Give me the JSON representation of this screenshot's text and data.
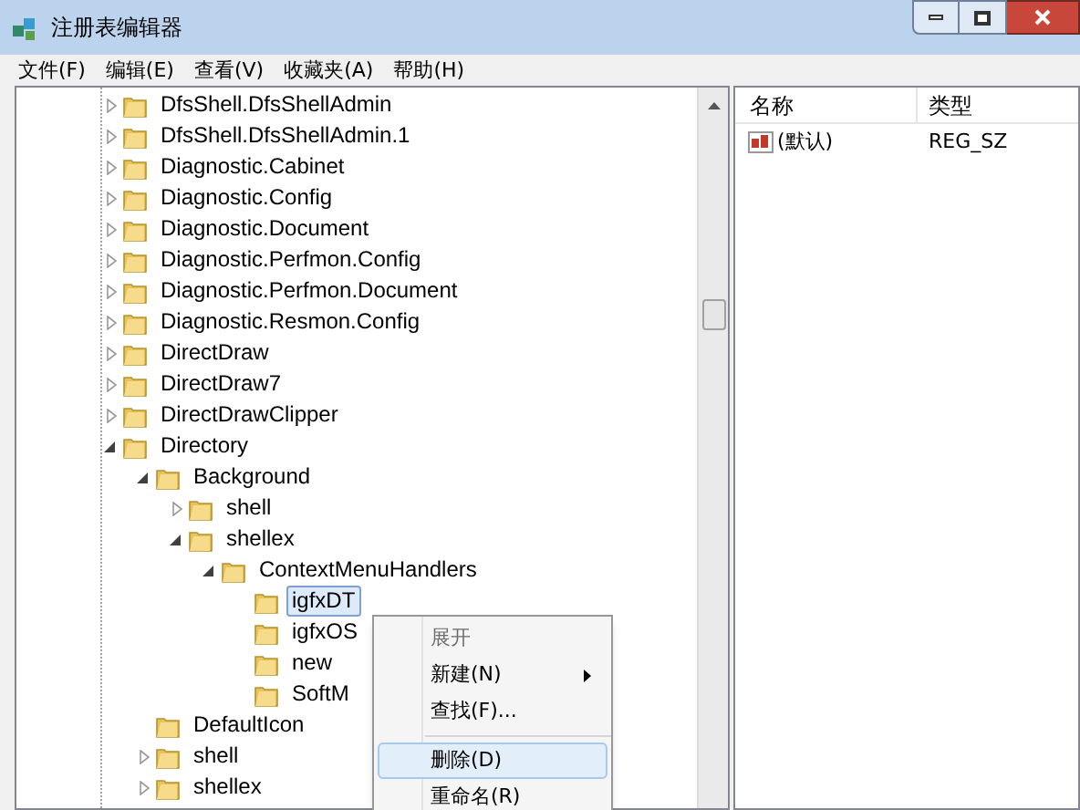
{
  "window": {
    "title": "注册表编辑器"
  },
  "menu": [
    "文件(F)",
    "编辑(E)",
    "查看(V)",
    "收藏夹(A)",
    "帮助(H)"
  ],
  "tree": [
    {
      "label": "DfsShell.DfsShellAdmin",
      "kind": "folder",
      "expanded": false,
      "selected": false
    },
    {
      "label": "DfsShell.DfsShellAdmin.1",
      "kind": "folder",
      "expanded": false,
      "selected": false
    },
    {
      "label": "Diagnostic.Cabinet",
      "kind": "folder",
      "expanded": false,
      "selected": false
    },
    {
      "label": "Diagnostic.Config",
      "kind": "folder",
      "expanded": false,
      "selected": false
    },
    {
      "label": "Diagnostic.Document",
      "kind": "folder",
      "expanded": false,
      "selected": false
    },
    {
      "label": "Diagnostic.Perfmon.Config",
      "kind": "folder",
      "expanded": false,
      "selected": false
    },
    {
      "label": "Diagnostic.Perfmon.Document",
      "kind": "folder",
      "expanded": false,
      "selected": false
    },
    {
      "label": "Diagnostic.Resmon.Config",
      "kind": "folder",
      "expanded": false,
      "selected": false
    },
    {
      "label": "DirectDraw",
      "kind": "folder",
      "expanded": false,
      "selected": false
    },
    {
      "label": "DirectDraw7",
      "kind": "folder",
      "expanded": false,
      "selected": false
    },
    {
      "label": "DirectDrawClipper",
      "kind": "folder",
      "expanded": false,
      "selected": false
    },
    {
      "label": "Directory",
      "kind": "folder",
      "expanded": true,
      "selected": false,
      "children": [
        {
          "label": "Background",
          "kind": "folder",
          "expanded": true,
          "selected": false,
          "children": [
            {
              "label": "shell",
              "kind": "folder",
              "expanded": false,
              "selected": false
            },
            {
              "label": "shellex",
              "kind": "folder",
              "expanded": true,
              "selected": false,
              "children": [
                {
                  "label": "ContextMenuHandlers",
                  "kind": "folder",
                  "expanded": true,
                  "selected": false,
                  "children": [
                    {
                      "label": "igfxDT",
                      "kind": "leaf",
                      "selected": true
                    },
                    {
                      "label": "igfxOS",
                      "kind": "leaf",
                      "selected": false
                    },
                    {
                      "label": "new",
                      "kind": "leaf",
                      "selected": false
                    },
                    {
                      "label": "SoftM",
                      "kind": "leaf",
                      "selected": false
                    }
                  ]
                }
              ]
            }
          ]
        },
        {
          "label": "DefaultIcon",
          "kind": "leaf",
          "selected": false
        },
        {
          "label": "shell",
          "kind": "folder",
          "expanded": false,
          "selected": false
        },
        {
          "label": "shellex",
          "kind": "folder",
          "expanded": false,
          "selected": false
        }
      ]
    }
  ],
  "values": {
    "columns": [
      "名称",
      "类型"
    ],
    "rows": [
      {
        "name": "(默认)",
        "type": "REG_SZ"
      }
    ]
  },
  "context_menu": [
    {
      "label": "展开",
      "kind": "item",
      "disabled": true,
      "submenu": false,
      "selected": false
    },
    {
      "label": "新建(N)",
      "kind": "item",
      "disabled": false,
      "submenu": true,
      "selected": false
    },
    {
      "label": "查找(F)...",
      "kind": "item",
      "disabled": false,
      "submenu": false,
      "selected": false
    },
    {
      "kind": "separator"
    },
    {
      "label": "删除(D)",
      "kind": "item",
      "disabled": false,
      "submenu": false,
      "selected": true
    },
    {
      "label": "重命名(R)",
      "kind": "item",
      "disabled": false,
      "submenu": false,
      "selected": false
    }
  ]
}
